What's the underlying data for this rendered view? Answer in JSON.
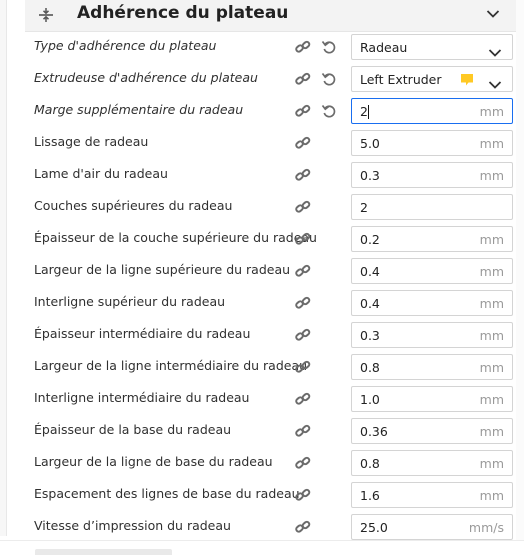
{
  "section": {
    "title": "Adhérence du plateau",
    "icon": "bed-adhesion-icon",
    "expanded": true
  },
  "rows": [
    {
      "label": "Type d'adhérence du plateau",
      "value": "Radeau",
      "unit": "",
      "kind": "dropdown",
      "italic": true,
      "reset": true
    },
    {
      "label": "Extrudeuse d'adhérence du plateau",
      "value": "Left Extruder",
      "unit": "",
      "kind": "extruder",
      "italic": true,
      "reset": true,
      "swatch_color": "#ffc924"
    },
    {
      "label": "Marge supplémentaire du radeau",
      "value": "2",
      "unit": "mm",
      "kind": "input-focused",
      "italic": true,
      "reset": true
    },
    {
      "label": "Lissage de radeau",
      "value": "5.0",
      "unit": "mm",
      "kind": "input",
      "italic": false,
      "reset": false
    },
    {
      "label": "Lame d'air du radeau",
      "value": "0.3",
      "unit": "mm",
      "kind": "input",
      "italic": false,
      "reset": false
    },
    {
      "label": "Couches supérieures du radeau",
      "value": "2",
      "unit": "",
      "kind": "input",
      "italic": false,
      "reset": false
    },
    {
      "label": "Épaisseur de la couche supérieure du radeau",
      "value": "0.2",
      "unit": "mm",
      "kind": "input",
      "italic": false,
      "reset": false
    },
    {
      "label": "Largeur de la ligne supérieure du radeau",
      "value": "0.4",
      "unit": "mm",
      "kind": "input",
      "italic": false,
      "reset": false
    },
    {
      "label": "Interligne supérieur du radeau",
      "value": "0.4",
      "unit": "mm",
      "kind": "input",
      "italic": false,
      "reset": false
    },
    {
      "label": "Épaisseur intermédiaire du radeau",
      "value": "0.3",
      "unit": "mm",
      "kind": "input",
      "italic": false,
      "reset": false
    },
    {
      "label": "Largeur de la ligne intermédiaire du radeau",
      "value": "0.8",
      "unit": "mm",
      "kind": "input",
      "italic": false,
      "reset": false
    },
    {
      "label": "Interligne intermédiaire du radeau",
      "value": "1.0",
      "unit": "mm",
      "kind": "input",
      "italic": false,
      "reset": false
    },
    {
      "label": "Épaisseur de la base du radeau",
      "value": "0.36",
      "unit": "mm",
      "kind": "input",
      "italic": false,
      "reset": false
    },
    {
      "label": "Largeur de la ligne de base du radeau",
      "value": "0.8",
      "unit": "mm",
      "kind": "input",
      "italic": false,
      "reset": false
    },
    {
      "label": "Espacement des lignes de base du radeau",
      "value": "1.6",
      "unit": "mm",
      "kind": "input",
      "italic": false,
      "reset": false
    },
    {
      "label": "Vitesse d’impression du radeau",
      "value": "25.0",
      "unit": "mm/s",
      "kind": "input",
      "italic": false,
      "reset": false
    }
  ],
  "colors": {
    "focus_border": "#196ef0",
    "icon_gray": "#6b6b6b",
    "extruder_yellow": "#ffc924"
  }
}
